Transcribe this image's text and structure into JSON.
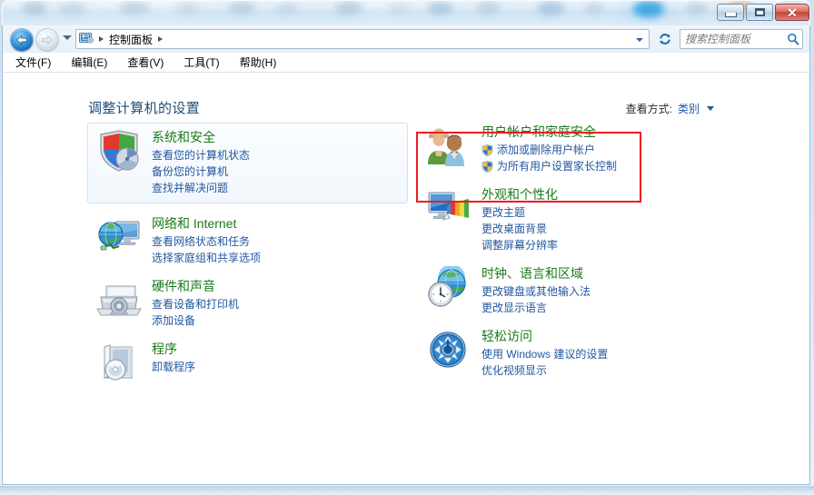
{
  "window": {
    "controls": {
      "minimize": "最小化",
      "maximize": "最大化",
      "close": "关闭"
    }
  },
  "toolbar": {
    "back_label": "后退",
    "forward_label": "前进",
    "history_label": "最近浏览的位置",
    "breadcrumb": [
      "控制面板"
    ],
    "address_dropdown_label": "以前的位置",
    "refresh_label": "刷新",
    "search": {
      "placeholder": "搜索控制面板",
      "value": ""
    }
  },
  "menu": {
    "items": [
      "文件(F)",
      "编辑(E)",
      "查看(V)",
      "工具(T)",
      "帮助(H)"
    ]
  },
  "page": {
    "title": "调整计算机的设置",
    "view_by_label": "查看方式:",
    "view_by_value": "类别"
  },
  "categories": {
    "left": [
      {
        "icon": "security-shield-icon",
        "title": "系统和安全",
        "hovered": true,
        "links": [
          {
            "text": "查看您的计算机状态",
            "shield": false
          },
          {
            "text": "备份您的计算机",
            "shield": false
          },
          {
            "text": "查找并解决问题",
            "shield": false
          }
        ]
      },
      {
        "icon": "network-internet-icon",
        "title": "网络和 Internet",
        "hovered": false,
        "links": [
          {
            "text": "查看网络状态和任务",
            "shield": false
          },
          {
            "text": "选择家庭组和共享选项",
            "shield": false
          }
        ]
      },
      {
        "icon": "hardware-sound-icon",
        "title": "硬件和声音",
        "hovered": false,
        "links": [
          {
            "text": "查看设备和打印机",
            "shield": false
          },
          {
            "text": "添加设备",
            "shield": false
          }
        ]
      },
      {
        "icon": "programs-icon",
        "title": "程序",
        "hovered": false,
        "links": [
          {
            "text": "卸载程序",
            "shield": false
          }
        ]
      }
    ],
    "right": [
      {
        "icon": "user-accounts-icon",
        "title": "用户帐户和家庭安全",
        "hovered": false,
        "annotated": true,
        "links": [
          {
            "text": "添加或删除用户帐户",
            "shield": true
          },
          {
            "text": "为所有用户设置家长控制",
            "shield": true
          }
        ]
      },
      {
        "icon": "appearance-personalization-icon",
        "title": "外观和个性化",
        "hovered": false,
        "links": [
          {
            "text": "更改主题",
            "shield": false
          },
          {
            "text": "更改桌面背景",
            "shield": false
          },
          {
            "text": "调整屏幕分辨率",
            "shield": false
          }
        ]
      },
      {
        "icon": "clock-language-region-icon",
        "title": "时钟、语言和区域",
        "hovered": false,
        "links": [
          {
            "text": "更改键盘或其他输入法",
            "shield": false
          },
          {
            "text": "更改显示语言",
            "shield": false
          }
        ]
      },
      {
        "icon": "ease-of-access-icon",
        "title": "轻松访问",
        "hovered": false,
        "links": [
          {
            "text": "使用 Windows 建议的设置",
            "shield": false
          },
          {
            "text": "优化视频显示",
            "shield": false
          }
        ]
      }
    ]
  },
  "colors": {
    "category_title": "#1a7a1a",
    "link": "#2257a0",
    "page_title": "#1f4e79",
    "annotation": "#ee1b24",
    "close_button": "#c4453a"
  }
}
